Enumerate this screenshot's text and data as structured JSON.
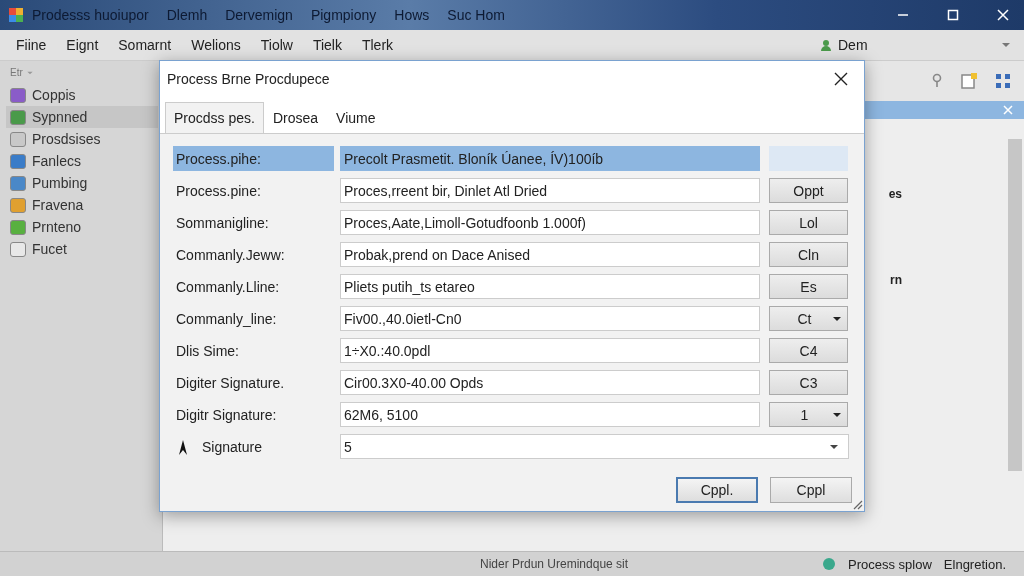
{
  "window": {
    "title_items": [
      "Prodesss huoiupor",
      "Dlemh",
      "Dervemign",
      "Pigmpiony",
      "Hows",
      "Suc Hom"
    ]
  },
  "menu": [
    "Fiine",
    "Eignt",
    "Somarnt",
    "Welions",
    "Tiolw",
    "Tielk",
    "Tlerk"
  ],
  "profile_dropdown": {
    "value": "Dem"
  },
  "filter_dropdown": {
    "value": "Etr"
  },
  "sidebar": {
    "items": [
      {
        "label": "Coppis",
        "selected": false,
        "color": "#8a5cc8"
      },
      {
        "label": "Sypnned",
        "selected": true,
        "color": "#4a9a4a"
      },
      {
        "label": "Prosdsises",
        "selected": false,
        "color": "#c8c8c8"
      },
      {
        "label": "Fanlecs",
        "selected": false,
        "color": "#3a7cc8"
      },
      {
        "label": "Pumbing",
        "selected": false,
        "color": "#4a88c8"
      },
      {
        "label": "Fravena",
        "selected": false,
        "color": "#e0a030"
      },
      {
        "label": "Prnteno",
        "selected": false,
        "color": "#58b040"
      },
      {
        "label": "Fucet",
        "selected": false,
        "color": "#e8e8e8"
      }
    ]
  },
  "background_panel": {
    "texts": [
      "es",
      "rn"
    ]
  },
  "dialog": {
    "title": "Process Brne Procdupece",
    "tabs": [
      {
        "label": "Procdss pes.",
        "selected": true
      },
      {
        "label": "Drosea",
        "selected": false
      },
      {
        "label": "Viume",
        "selected": false
      }
    ],
    "rows": [
      {
        "label": "Process.pihe:",
        "value": "Precolt Prasmetit. Bloník Úanee, ÍV)100íb",
        "kind": "none",
        "selected": true
      },
      {
        "label": "Process.pine:",
        "value": "Proces,rreent bir, Dinlet Atl Dried",
        "kind": "button",
        "button": "Oppt",
        "selected": false
      },
      {
        "label": "Sommanigline:",
        "value": "Proces,Aate,Limoll-Gotudfoonb 1.000f)",
        "kind": "button",
        "button": "Lol",
        "selected": false
      },
      {
        "label": "Commanly.Jeww:",
        "value": "Probak,prend on Dace Anised",
        "kind": "button",
        "button": "Cln",
        "selected": false
      },
      {
        "label": "Commanly.Lline:",
        "value": "Pliets putih_ts etareo",
        "kind": "button",
        "button": "Es",
        "selected": false
      },
      {
        "label": "Commanly_line:",
        "value": "Fiv00.,40.0ietl-Cn0",
        "kind": "dropdown",
        "button": "Ct",
        "selected": false
      },
      {
        "label": "Dlis Sime:",
        "value": "1÷X0.:40.0pdl",
        "kind": "button",
        "button": "C4",
        "selected": false
      },
      {
        "label": "Digiter Signature.",
        "value": "Cir00.3X0-40.00 Opds",
        "kind": "button",
        "button": "C3",
        "selected": false
      },
      {
        "label": "Digitr Signature:",
        "value": "62M6, 5100",
        "kind": "dropdown",
        "button": "1",
        "selected": false
      },
      {
        "label": "Signature",
        "value": "5",
        "kind": "combo",
        "selected": false
      }
    ],
    "buttons": [
      {
        "label": "Cppl.",
        "selected": true
      },
      {
        "label": "Cppl",
        "selected": false
      }
    ]
  },
  "status_bar": {
    "left": "Nider Prdun Uremindque sit",
    "right": [
      "Process splow",
      "Elngretion."
    ]
  }
}
